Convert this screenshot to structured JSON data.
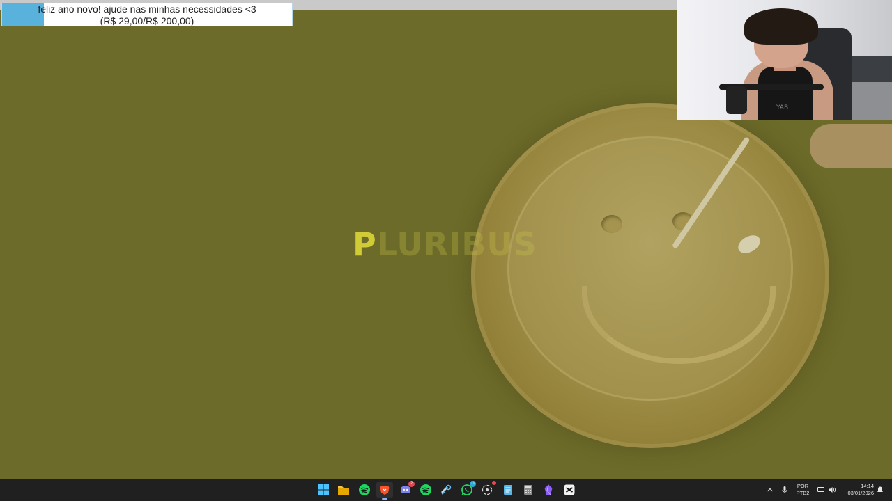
{
  "alert": {
    "message": "feliz ano novo! ajude nas minhas necessidades <3",
    "amount": "(R$ 29,00/R$ 200,00)",
    "progress_percent": 14.5,
    "progress_color": "#59b2dc"
  },
  "video": {
    "title_first_letter": "P",
    "title_rest": "LURIBUS",
    "background_color": "#6c6b29"
  },
  "webcam": {
    "shirt_text": "YAB"
  },
  "taskbar": {
    "apps": [
      {
        "name": "windows-start-icon"
      },
      {
        "name": "file-explorer-icon"
      },
      {
        "name": "spotify-icon"
      },
      {
        "name": "brave-browser-icon",
        "active": true
      },
      {
        "name": "discord-icon",
        "badge": "2"
      },
      {
        "name": "spotify-icon"
      },
      {
        "name": "steam-icon"
      },
      {
        "name": "whatsapp-icon",
        "badge": "11"
      },
      {
        "name": "chatgpt-icon"
      },
      {
        "name": "notepad-icon"
      },
      {
        "name": "calculator-icon"
      },
      {
        "name": "obsidian-icon"
      },
      {
        "name": "capcut-icon"
      }
    ],
    "language": "POR",
    "keyboard_layout": "PTB2",
    "time": "14:14",
    "date": "03/01/2026"
  }
}
